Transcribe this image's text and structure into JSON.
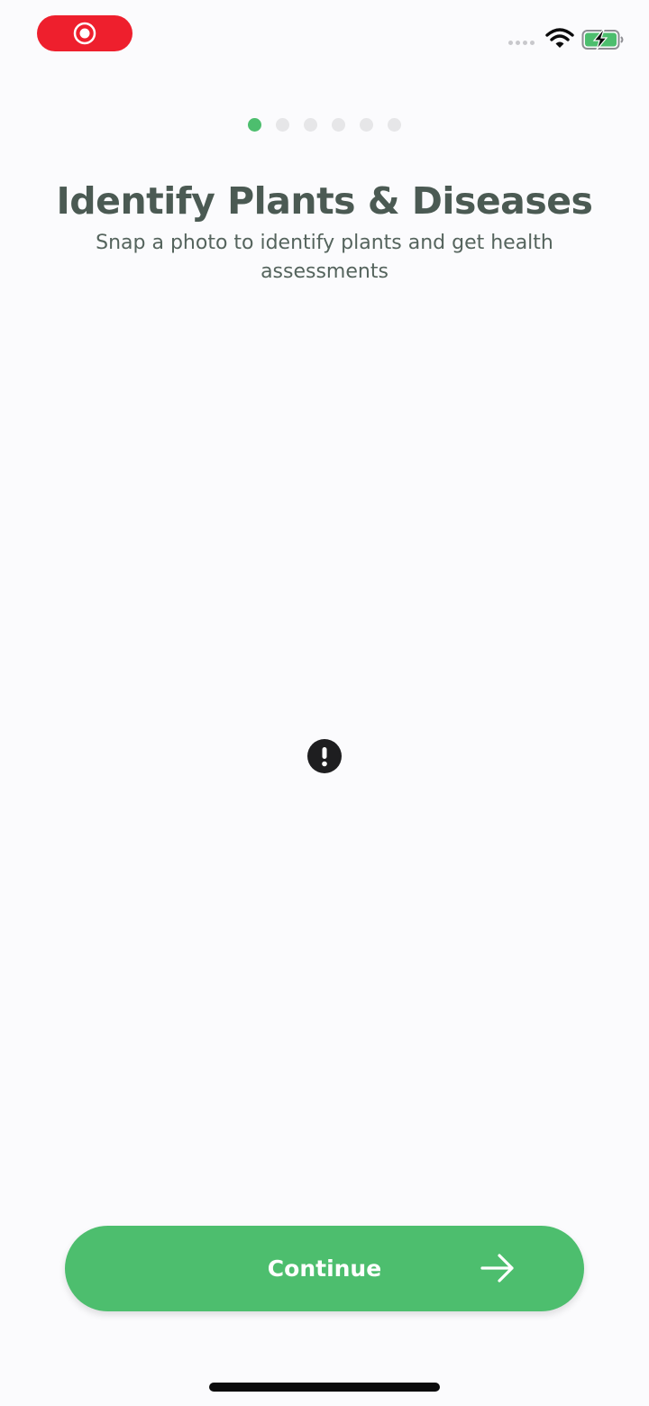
{
  "status_bar": {
    "record_icon": "screen-record-icon",
    "wifi_icon": "wifi-icon",
    "battery_icon": "battery-charging-icon",
    "record_color": "#EE1F2D",
    "battery_color": "#4DBE6E"
  },
  "onboarding": {
    "page_count": 6,
    "active_page": 1,
    "title": "Identify Plants & Diseases",
    "subtitle": "Snap a photo to identify plants and get health assessments",
    "image_placeholder_icon": "exclamation-circle-icon"
  },
  "continue_button": {
    "label": "Continue",
    "icon": "arrow-right-icon",
    "color": "#4DBE6E"
  }
}
